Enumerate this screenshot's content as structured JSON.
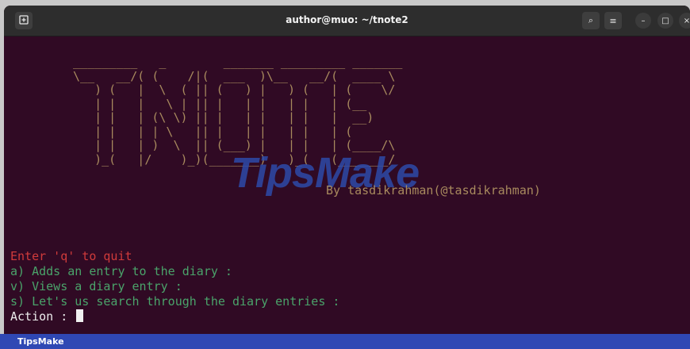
{
  "window": {
    "title": "author@muo: ~/tnote2",
    "new_tab_icon": "new-tab-icon",
    "search_icon": "⌕",
    "menu_icon": "≡",
    "minimize_icon": "–",
    "maximize_icon": "□",
    "close_icon": "×"
  },
  "terminal": {
    "ascii_art": " _________   _        _______ _________ _______ \n \\__   __/( (    /|(  ___  )\\__   __/(  ____ \\\n    ) (   |  \\  ( || (   ) |   ) (   | (    \\/\n    | |   |   \\ | || |   | |   | |   | (__    \n    | |   | (\\ \\) || |   | |   | |   |  __)   \n    | |   | | \\   || |   | |   | |   | (      \n    | |   | )  \\  || (___) |   | |   | (____/\\\n    )_(   |/    )_)(_______)   )_(   (_______/",
    "byline": "By tasdikrahman(@tasdikrahman)",
    "quit_line": "Enter 'q' to quit",
    "option_a": "a) Adds an entry to the diary :",
    "option_v": "v) Views a diary entry :",
    "option_s": "s) Let's us search through the diary entries :",
    "prompt": "Action : ",
    "colors": {
      "ascii": "#a88a5e",
      "red": "#d03b3b",
      "green": "#4aa36a",
      "background": "#300a24"
    }
  },
  "watermark": {
    "text": "TipsMake"
  },
  "footer": {
    "brand": "TipsMake"
  }
}
